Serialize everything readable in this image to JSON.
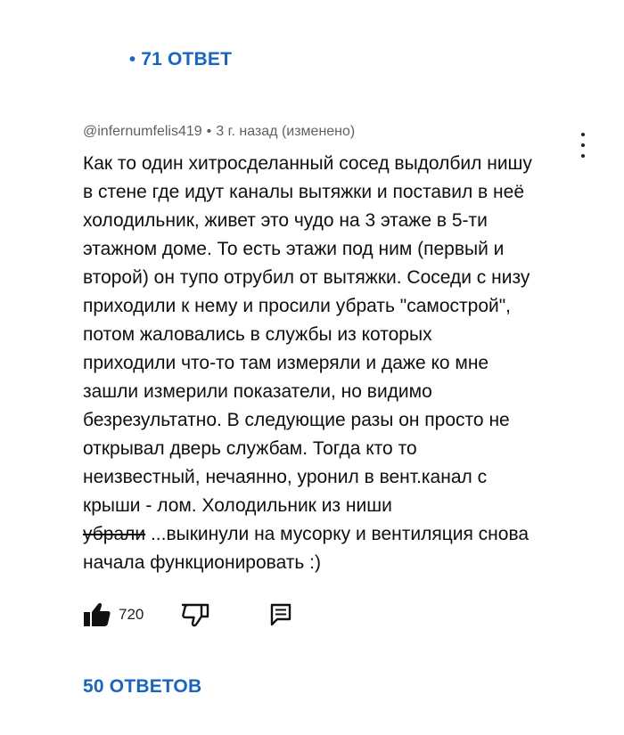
{
  "top_replies": {
    "bullet": "•",
    "label": "71 ОТВЕТ"
  },
  "comment": {
    "author": "@infernumfelis419",
    "separator": "•",
    "time": "3 г. назад (изменено)",
    "lines": [
      "Как то один хитросделанный сосед выдолбил нишу",
      "в стене где идут каналы вытяжки и поставил в неё",
      "холодильник, живет это чудо на 3 этаже в 5-ти",
      "этажном доме. То есть этажи под ним (первый и",
      "второй) он тупо отрубил от вытяжки. Соседи с низу",
      "приходили к нему и просили убрать \"самострой\",",
      "потом  жаловались в службы из которых",
      "приходили что-то там измеряли и даже ко мне",
      "зашли измерили показатели, но видимо",
      "безрезультатно. В следующие разы он просто не",
      "открывал дверь службам. Тогда кто то",
      "неизвестный, нечаянно, уронил в вент.канал с",
      "крыши - лом. Холодильник из ниши"
    ],
    "strike_word": "убрали",
    "line_after_strike": " ...выкинули на мусорку и вентиляция снова",
    "last_line": "начала функционировать :)",
    "likes": "720"
  },
  "icons": {
    "like": "thumbs-up-icon",
    "dislike": "thumbs-down-icon",
    "reply": "reply-comment-icon",
    "more": "more-vertical-icon"
  },
  "colors": {
    "link": "#1a65c0",
    "text": "#0f0f0f",
    "meta": "#606060"
  },
  "bottom_replies": {
    "label": "50 ОТВЕТОВ"
  }
}
